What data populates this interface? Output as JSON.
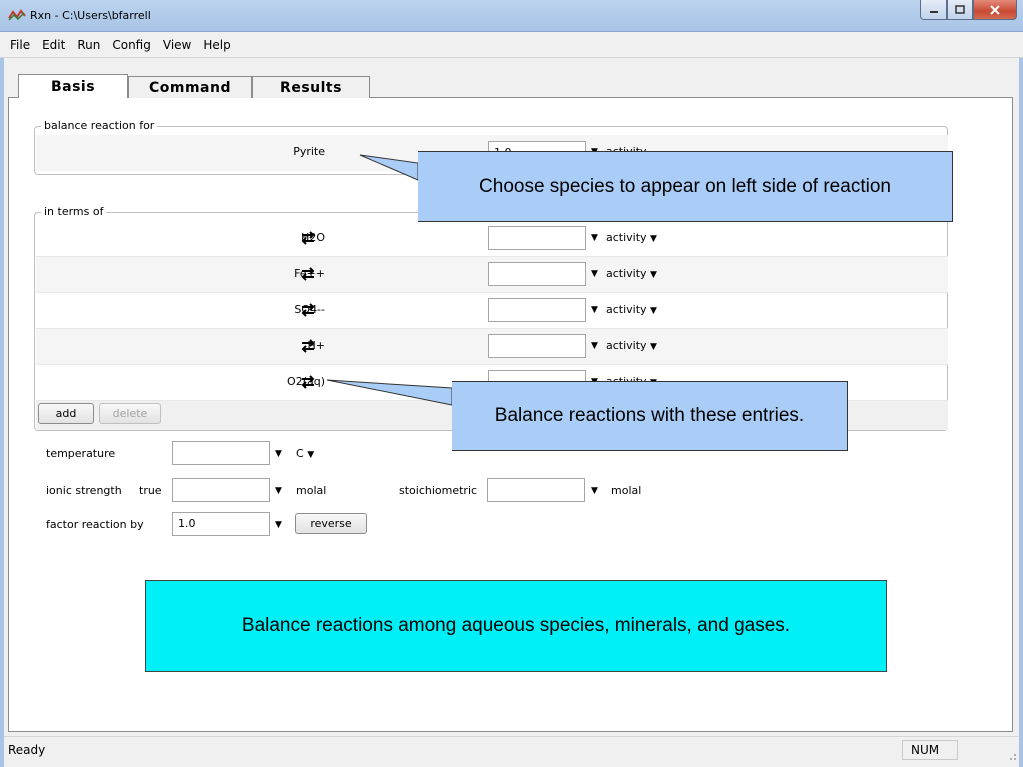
{
  "window": {
    "title": "Rxn - C:\\Users\\bfarrell"
  },
  "menu": [
    "File",
    "Edit",
    "Run",
    "Config",
    "View",
    "Help"
  ],
  "tabs": [
    "Basis",
    "Command",
    "Results"
  ],
  "balance_group": {
    "legend": "balance reaction for",
    "species": "Pyrite",
    "value": "1.0",
    "unit": "activity"
  },
  "terms_group": {
    "legend": "in terms of",
    "rows": [
      {
        "species": "H2O",
        "value": "",
        "unit": "activity"
      },
      {
        "species": "Fe++",
        "value": "",
        "unit": "activity"
      },
      {
        "species": "SO4--",
        "value": "",
        "unit": "activity"
      },
      {
        "species": "H+",
        "value": "",
        "unit": "activity"
      },
      {
        "species": "O2(aq)",
        "value": "",
        "unit": "activity"
      }
    ],
    "add_label": "add",
    "delete_label": "delete"
  },
  "conditions": {
    "temperature_label": "temperature",
    "temperature_value": "",
    "temperature_unit": "C",
    "ionic_label": "ionic strength",
    "ionic_true_label": "true",
    "ionic_value": "",
    "ionic_unit": "molal",
    "stoich_label": "stoichiometric",
    "stoich_value": "",
    "stoich_unit": "molal",
    "factor_label": "factor reaction by",
    "factor_value": "1.0",
    "reverse_label": "reverse"
  },
  "callouts": {
    "species": "Choose species to appear on left side of reaction",
    "balance": "Balance reactions with these entries.",
    "summary": "Balance reactions among aqueous species, minerals, and gases."
  },
  "status": {
    "text": "Ready",
    "num": "NUM"
  },
  "colors": {
    "callout": "#a9cdf7",
    "summary_box": "#00f0f8"
  }
}
